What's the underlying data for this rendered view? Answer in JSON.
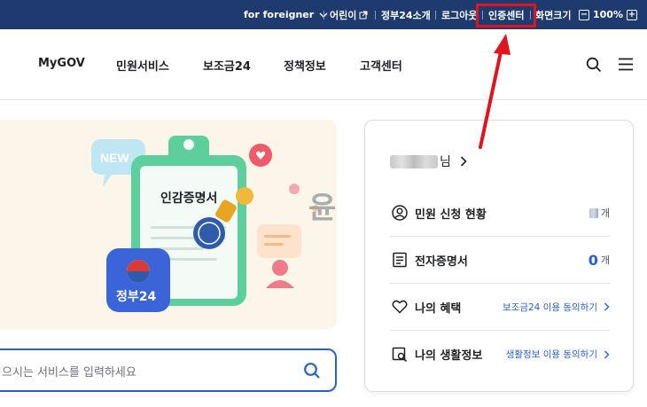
{
  "topbar": {
    "foreigner": "for foreigner",
    "kids": "어린이",
    "about": "정부24소개",
    "logout": "로그아웃",
    "cert_center": "인증센터",
    "screen_size": "화면크기",
    "zoom_level": "100%"
  },
  "nav": {
    "items": [
      "MyGOV",
      "민원서비스",
      "보조금24",
      "정책정보",
      "고객센터"
    ]
  },
  "hero": {
    "new_badge": "NEW",
    "document_title": "인감증명서",
    "app_label": "정부24",
    "yun_char": "윤"
  },
  "search": {
    "placeholder": "으시는 서비스를 입력하세요"
  },
  "card": {
    "user_suffix": "님",
    "rows": [
      {
        "label": "민원 신청 현황",
        "unit": "개"
      },
      {
        "label": "전자증명서",
        "value": "0",
        "unit": "개"
      },
      {
        "label": "나의 혜택",
        "link": "보조금24 이용 동의하기"
      },
      {
        "label": "나의 생활정보",
        "link": "생활정보 이용 동의하기"
      }
    ]
  },
  "colors": {
    "topbar_bg": "#1f3a6e",
    "accent_blue": "#2a5fd0",
    "annotation_red": "#e0141e"
  }
}
